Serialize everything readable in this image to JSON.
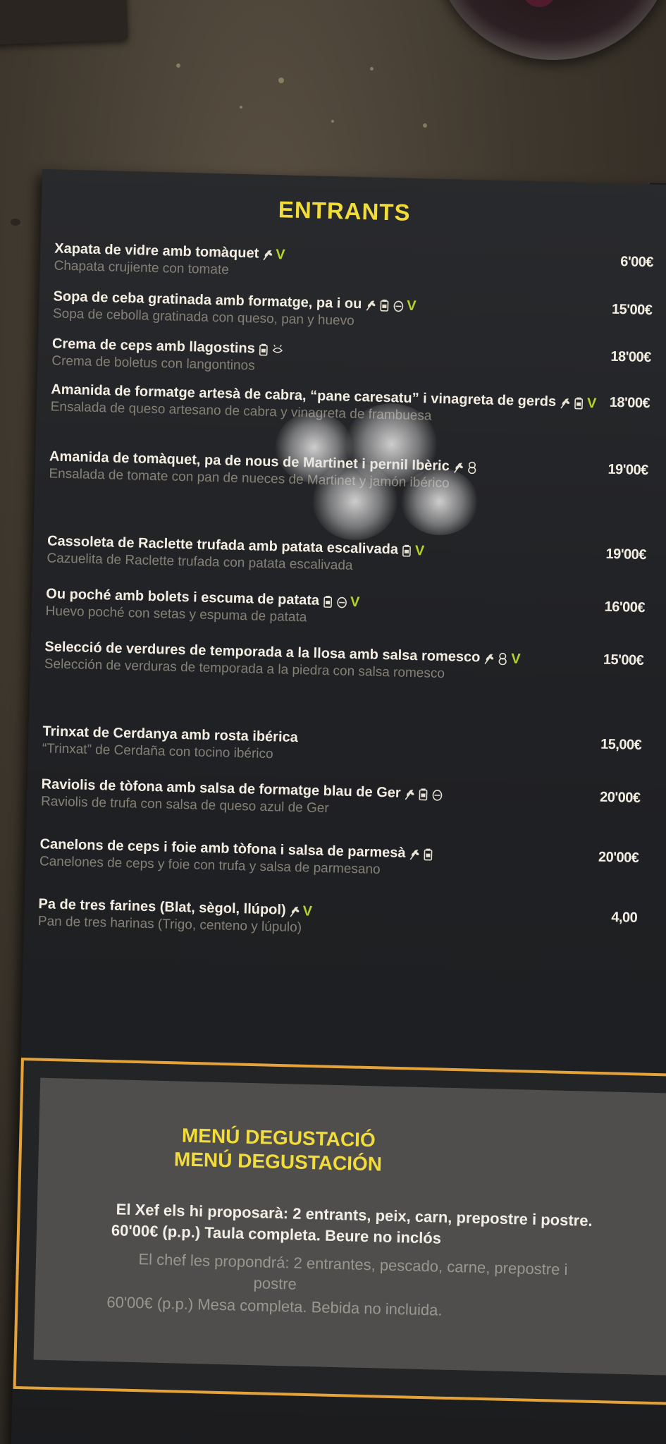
{
  "section": {
    "title": "ENTRANTS"
  },
  "items": [
    {
      "name": "Xapata de vidre amb tomàquet",
      "desc": "Chapata crujiente con tomate",
      "price": "6'00€",
      "icons": [
        "wheat",
        "vegan"
      ]
    },
    {
      "name": "Sopa de ceba gratinada amb formatge, pa i ou",
      "desc": "Sopa de cebolla gratinada con queso, pan y huevo",
      "price": "15'00€",
      "icons": [
        "wheat",
        "milk",
        "egg",
        "vegan"
      ]
    },
    {
      "name": "Crema de ceps amb llagostins",
      "desc": "Crema de boletus con langontinos",
      "price": "18'00€",
      "icons": [
        "milk",
        "crustacean"
      ]
    },
    {
      "name": "Amanida de formatge artesà de cabra, “pane caresatu” i vinagreta de gerds",
      "desc": "Ensalada de queso artesano de cabra y vinagreta de frambuesa",
      "price": "18'00€",
      "icons": [
        "wheat",
        "milk",
        "vegan"
      ]
    },
    {
      "name": "Amanida de tomàquet, pa de nous de Martinet i pernil Ibèric",
      "desc": "Ensalada de tomate con pan de nueces de Martinet y jamón ibérico",
      "price": "19'00€",
      "icons": [
        "wheat",
        "nuts"
      ]
    },
    {
      "name": "Cassoleta de Raclette trufada amb patata escalivada",
      "desc": "Cazuelita de Raclette trufada con patata escalivada",
      "price": "19'00€",
      "icons": [
        "milk",
        "vegan"
      ]
    },
    {
      "name": "Ou poché amb bolets i escuma de patata",
      "desc": "Huevo poché con setas y espuma de patata",
      "price": "16'00€",
      "icons": [
        "milk",
        "egg",
        "vegan"
      ]
    },
    {
      "name": "Selecció de verdures de temporada a la llosa amb salsa romesco",
      "desc": "Selección de verduras de temporada a la piedra con salsa romesco",
      "price": "15'00€",
      "icons": [
        "wheat",
        "nuts",
        "vegan"
      ]
    },
    {
      "name": "Trinxat de Cerdanya amb rosta ibérica",
      "desc": "“Trinxat” de Cerdaña con tocino ibérico",
      "price": "15,00€",
      "icons": []
    },
    {
      "name": "Raviolis de tòfona amb salsa de formatge blau de Ger",
      "desc": "Raviolis de trufa con salsa de queso azul de Ger",
      "price": "20'00€",
      "icons": [
        "wheat",
        "milk",
        "egg"
      ]
    },
    {
      "name": "Canelons de ceps i foie amb tòfona i salsa de parmesà",
      "desc": "Canelones de ceps y foie con trufa y salsa de parmesano",
      "price": "20'00€",
      "icons": [
        "wheat",
        "milk"
      ]
    },
    {
      "name": "Pa de tres farines (Blat, sègol, llúpol)",
      "desc": "Pan de tres harinas (Trigo, centeno y lúpulo)",
      "price": "4,00",
      "icons": [
        "wheat",
        "vegan"
      ]
    }
  ],
  "tasting": {
    "title_ca": "MENÚ DEGUSTACIÓ",
    "title_es": "MENÚ DEGUSTACIÓN",
    "line1_ca": "El Xef  els hi proposarà: 2 entrants, peix, carn, prepostre i postre.",
    "line2_ca": "60'00€ (p.p.) Taula completa. Beure no inclós",
    "line1_es": "El chef les propondrá: 2 entrantes, pescado, carne, prepostre i",
    "line2_es": "postre",
    "line3_es": "60'00€ (p.p.) Mesa completa. Bebida no incluida."
  },
  "icon_legend": {
    "wheat": "wheat-icon",
    "milk": "milk-icon",
    "egg": "egg-icon",
    "nuts": "nuts-icon",
    "crustacean": "crustacean-icon",
    "vegan": "vegan-icon"
  },
  "colors": {
    "title": "#f2dc3a",
    "vegan": "#b5d22b",
    "frame": "#e4a33a",
    "card": "#202124"
  }
}
